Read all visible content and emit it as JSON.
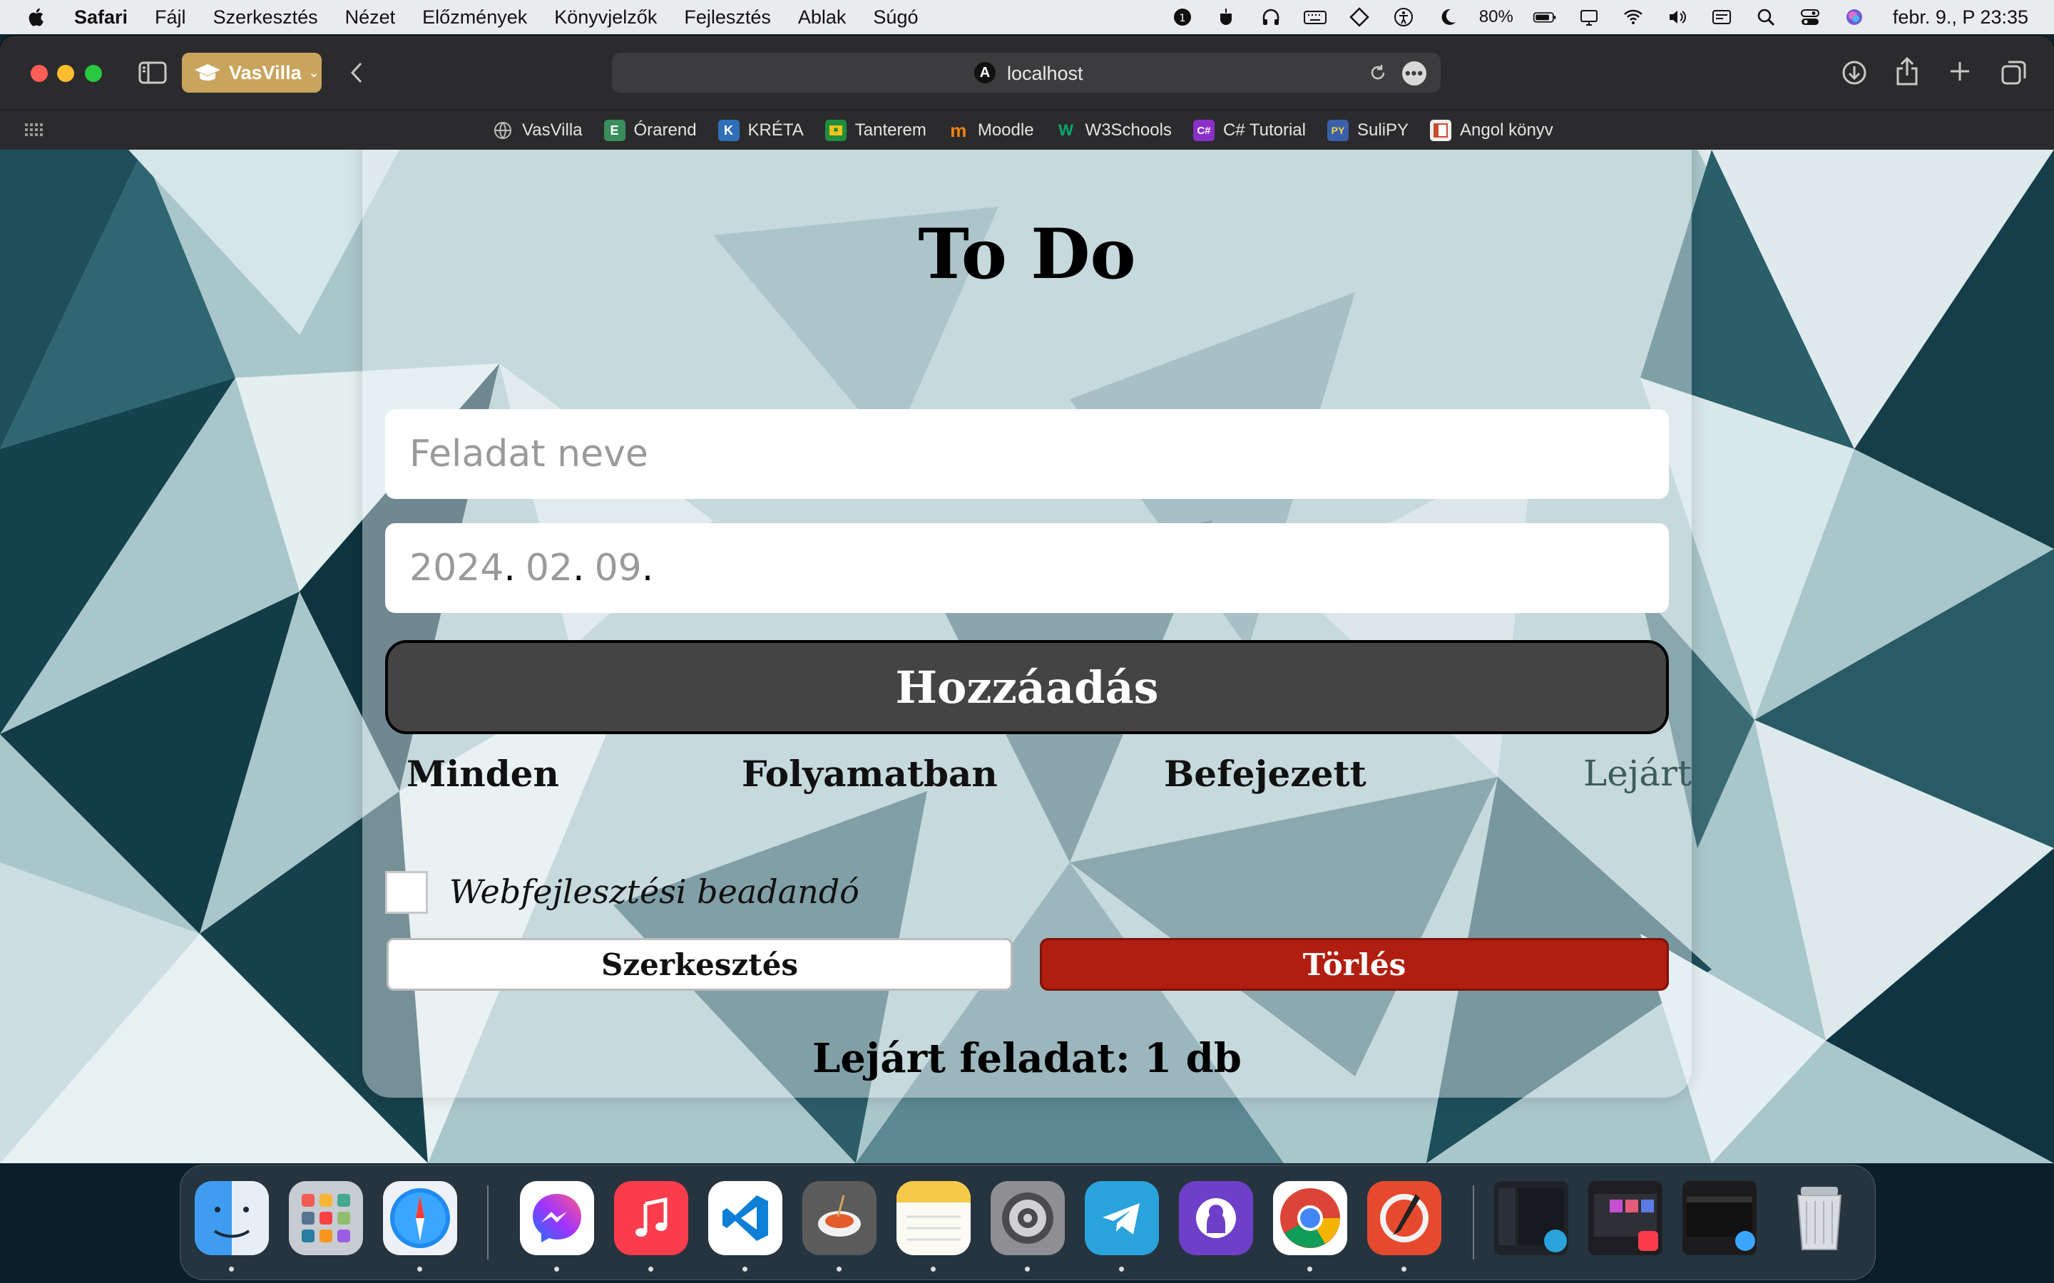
{
  "menubar": {
    "app_name": "Safari",
    "menus": [
      "Fájl",
      "Szerkesztés",
      "Nézet",
      "Előzmények",
      "Könyvjelzők",
      "Fejlesztés",
      "Ablak",
      "Súgó"
    ],
    "battery": "80%",
    "clock": "febr. 9., P  23:35",
    "status_icons": [
      "screen-time-icon",
      "coffee-icon",
      "headphones-icon",
      "keyboard-icon",
      "diamond-icon",
      "accessibility-icon",
      "focus-moon-icon"
    ]
  },
  "browser": {
    "profile_label": "VasVilla",
    "url": "localhost",
    "site_icon_letter": "A",
    "favorites": [
      {
        "label": "VasVilla",
        "icon": "globe-icon",
        "color": "#2b2b2d"
      },
      {
        "label": "Órarend",
        "icon": "orarend-icon",
        "color": "#3a8d5c"
      },
      {
        "label": "KRÉTA",
        "icon": "kreta-icon",
        "color": "#2f6fb8"
      },
      {
        "label": "Tanterem",
        "icon": "classroom-icon",
        "color": "#1e8e3e"
      },
      {
        "label": "Moodle",
        "icon": "moodle-icon",
        "color": "#f98012"
      },
      {
        "label": "W3Schools",
        "icon": "w3schools-icon",
        "color": "#04aa6d"
      },
      {
        "label": "C# Tutorial",
        "icon": "csharp-icon",
        "color": "#8b2fc9"
      },
      {
        "label": "SuliPY",
        "icon": "sulipy-icon",
        "color": "#3b5fa8"
      },
      {
        "label": "Angol könyv",
        "icon": "book-icon",
        "color": "#c84b2f"
      }
    ],
    "favorite_icon_text": [
      "",
      "E",
      "K",
      "",
      "m",
      "W",
      "C#",
      "PY",
      ""
    ]
  },
  "todo": {
    "title": "To Do",
    "name_placeholder": "Feladat neve",
    "date": {
      "year": "2024",
      "month": "02",
      "day": "09",
      "separator": "."
    },
    "add_button": "Hozzáadás",
    "filters": [
      "Minden",
      "Folyamatban",
      "Befejezett",
      "Lejárt"
    ],
    "active_filter": "Lejárt",
    "tasks": [
      {
        "name": "Webfejlesztési beadandó",
        "done": false,
        "edit_label": "Szerkesztés",
        "delete_label": "Törlés"
      }
    ],
    "expired_summary": "Lejárt feladat: 1 db"
  },
  "colors": {
    "add_button_bg": "#444444",
    "delete_button_bg": "#b01e10",
    "active_filter": "#3c5c5f",
    "profile_badge": "#c9a45d"
  },
  "dock": {
    "apps": [
      {
        "name": "finder-icon",
        "color": "#3f9cf0",
        "running": true
      },
      {
        "name": "launchpad-icon",
        "color": "#c7cbd2",
        "running": false
      },
      {
        "name": "safari-icon",
        "color": "#eef2f7",
        "running": true
      },
      {
        "name": "messenger-icon",
        "color": "#ffffff",
        "running": true
      },
      {
        "name": "music-icon",
        "color": "#fa3c4c",
        "running": true
      },
      {
        "name": "vscode-icon",
        "color": "#ffffff",
        "running": true
      },
      {
        "name": "pasta-app-icon",
        "color": "#5b5b5b",
        "running": true
      },
      {
        "name": "notes-icon",
        "color": "#fbfbf4",
        "running": true
      },
      {
        "name": "system-settings-icon",
        "color": "#8e8e93",
        "running": true
      },
      {
        "name": "telegram-icon",
        "color": "#2aa3dd",
        "running": true
      },
      {
        "name": "github-desktop-icon",
        "color": "#6e40c9",
        "running": false
      },
      {
        "name": "chrome-icon",
        "color": "#ffffff",
        "running": true
      },
      {
        "name": "pixelmator-icon",
        "color": "#e64a2e",
        "running": true
      }
    ],
    "recent_items": [
      "telegram-window-thumbnail",
      "music-window-thumbnail",
      "safari-window-thumbnail"
    ],
    "trash": "trash-icon"
  }
}
